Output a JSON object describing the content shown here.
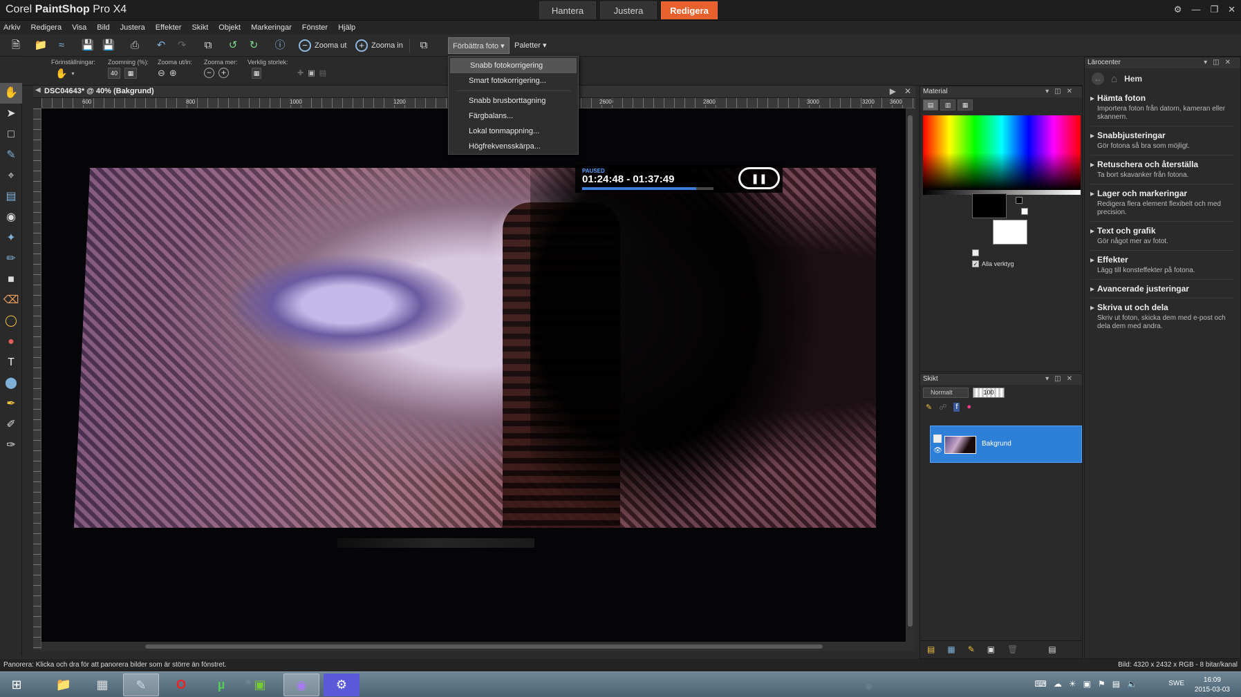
{
  "app": {
    "title_prefix": "Corel",
    "title_brand": "PaintShop",
    "title_suffix": "Pro X4",
    "workspace_tabs": [
      "Hantera",
      "Justera",
      "Redigera"
    ],
    "active_workspace": "Redigera",
    "accent_color": "#e8612c"
  },
  "menubar": [
    "Arkiv",
    "Redigera",
    "Visa",
    "Bild",
    "Justera",
    "Effekter",
    "Skikt",
    "Objekt",
    "Markeringar",
    "Fönster",
    "Hjälp"
  ],
  "toolbar": {
    "zoom_out_label": "Zooma ut",
    "zoom_in_label": "Zooma in",
    "enhance_label": "Förbättra foto",
    "palettes_label": "Paletter"
  },
  "options": {
    "presets_label": "Förinställningar:",
    "zoom_label": "Zoomning (%):",
    "zoom_value": "40",
    "zoom_inout_label": "Zooma ut/in:",
    "zoom_more_label": "Zooma mer:",
    "actual_size_label": "Verklig storlek:"
  },
  "enhance_menu": {
    "items": [
      "Snabb fotokorrigering",
      "Smart fotokorrigering...",
      "Snabb brusborttagning",
      "Färgbalans...",
      "Lokal tonmappning...",
      "Högfrekvensskärpa..."
    ],
    "highlighted": "Snabb fotokorrigering"
  },
  "document": {
    "tab_title": "DSC04643* @  40% (Bakgrund)",
    "ruler_marks": [
      "600",
      "800",
      "1000",
      "1200",
      "1400",
      "1600",
      "2600",
      "2800",
      "3000",
      "3200",
      "3400",
      "3600"
    ]
  },
  "osd": {
    "state": "PAUSED",
    "time": "01:24:48 - 01:37:49",
    "progress": 0.87
  },
  "material": {
    "title": "Material",
    "all_tools_label": "Alla verktyg"
  },
  "layers": {
    "title": "Skikt",
    "blend_mode": "Normalt",
    "opacity": "100",
    "layer_name": "Bakgrund"
  },
  "learning": {
    "title": "Lärocenter",
    "home_label": "Hem",
    "items": [
      {
        "title": "Hämta foton",
        "desc": "Importera foton från datorn, kameran eller skannern."
      },
      {
        "title": "Snabbjusteringar",
        "desc": "Gör fotona så bra som möjligt."
      },
      {
        "title": "Retuschera och återställa",
        "desc": "Ta bort skavanker från fotona."
      },
      {
        "title": "Lager och markeringar",
        "desc": "Redigera flera element flexibelt och med precision."
      },
      {
        "title": "Text och grafik",
        "desc": "Gör något mer av fotot."
      },
      {
        "title": "Effekter",
        "desc": "Lägg till konsteffekter på fotona."
      },
      {
        "title": "Avancerade justeringar",
        "desc": ""
      },
      {
        "title": "Skriva ut och dela",
        "desc": "Skriv ut foton, skicka dem med e-post och dela dem med andra."
      }
    ]
  },
  "status": {
    "left": "Panorera: Klicka och dra för att panorera bilder som är större än fönstret.",
    "right": "Bild:  4320 x 2432 x RGB - 8 bitar/kanal"
  },
  "taskbar": {
    "language": "SWE",
    "time": "16:09",
    "date": "2015-03-03"
  }
}
